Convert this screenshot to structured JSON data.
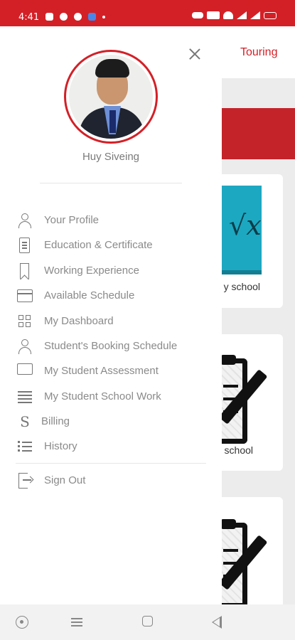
{
  "status_bar": {
    "time": "4:41",
    "left_icons": [
      "youtube-icon",
      "messenger-icon",
      "telegram-icon",
      "app-icon"
    ],
    "right_icons": [
      "vibrate-icon",
      "data-speed-icon",
      "wifi-icon",
      "signal-icon",
      "signal-icon",
      "battery-icon"
    ]
  },
  "background_app": {
    "header_title": "Touring",
    "cards": [
      {
        "label": "y school",
        "image": "math-book"
      },
      {
        "label": "school",
        "image": "clipboard-pencil"
      },
      {
        "label": "",
        "image": "clipboard-pencil"
      }
    ]
  },
  "drawer": {
    "user_name": "Huy Siveing",
    "menu_items": [
      {
        "label": "Your Profile",
        "icon": "person-icon"
      },
      {
        "label": "Education & Certificate",
        "icon": "document-icon"
      },
      {
        "label": "Working Experience",
        "icon": "bookmark-icon"
      },
      {
        "label": "Available Schedule",
        "icon": "calendar-icon"
      },
      {
        "label": "My Dashboard",
        "icon": "grid-icon"
      },
      {
        "label": "Student's Booking Schedule",
        "icon": "person-icon"
      },
      {
        "label": "My Student Assessment",
        "icon": "chat-icon"
      },
      {
        "label": "My Student School Work",
        "icon": "lines-icon"
      },
      {
        "label": "Billing",
        "icon": "currency-icon"
      },
      {
        "label": "History",
        "icon": "list-icon"
      }
    ],
    "sign_out": {
      "label": "Sign Out",
      "icon": "logout-icon"
    }
  },
  "colors": {
    "brand_red": "#d32027",
    "menu_text": "#8a8a8a",
    "icon_gray": "#777777"
  },
  "nav_bar": [
    "home-circle-icon",
    "menu-icon",
    "recents-square-icon",
    "back-triangle-icon"
  ]
}
